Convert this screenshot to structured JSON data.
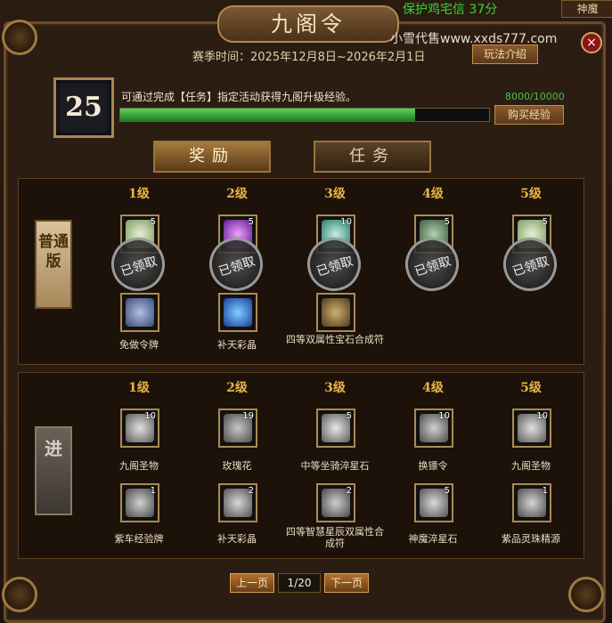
{
  "window": {
    "title": "九阁令",
    "top_tag": "保护鸡宅信 37分",
    "top_right_tag": "神魔",
    "watermark": "小雪代售www.xxds777.com",
    "close_icon": "×"
  },
  "header": {
    "season_label": "赛季时间：2025年12月8日~2026年2月1日",
    "rules_button": "玩法介绍",
    "level": "25",
    "description": "可通过完成【任务】指定活动获得九阁升级经验。",
    "exp_text": "8000/10000",
    "exp_progress": 0.8,
    "buy_exp_button": "购买经验"
  },
  "tabs": [
    {
      "label": "奖励",
      "active": true
    },
    {
      "label": "任务",
      "active": false
    }
  ],
  "tiers": {
    "normal": {
      "badge": "普通版",
      "levels": [
        "1级",
        "2级",
        "3级",
        "4级",
        "5级"
      ],
      "claimed_label": "已领取",
      "items_top": [
        {
          "count": "5",
          "color": "#c8d8b0"
        },
        {
          "count": "5",
          "color": "#9a5ad0"
        },
        {
          "count": "10",
          "color": "#6ab8a0"
        },
        {
          "count": "5",
          "color": "#7a9a7a"
        },
        {
          "count": "5",
          "color": "#c8d8b0"
        }
      ],
      "items_bottom": [
        {
          "name": "免做令牌",
          "color": "#6a7aa8"
        },
        {
          "name": "补天彩晶",
          "color": "#4a78c8"
        },
        {
          "name": "四等双属性宝石合成符",
          "color": "#7a6a40"
        },
        {
          "name": "",
          "color": ""
        },
        {
          "name": "",
          "color": ""
        }
      ]
    },
    "advanced": {
      "badge": "进",
      "levels": [
        "1级",
        "2级",
        "3级",
        "4级",
        "5级"
      ],
      "items_top": [
        {
          "name": "九阁圣物",
          "count": "10",
          "color": "#a8a8a8"
        },
        {
          "name": "玫瑰花",
          "count": "19",
          "color": "#8a8a8a"
        },
        {
          "name": "中等坐骑淬星石",
          "count": "5",
          "color": "#b0b0b0"
        },
        {
          "name": "换镖令",
          "count": "10",
          "color": "#9a9a9a"
        },
        {
          "name": "九阁圣物",
          "count": "10",
          "color": "#a8a8a8"
        }
      ],
      "items_bottom": [
        {
          "name": "紫车经验牌",
          "count": "1",
          "color": "#8a8a8a"
        },
        {
          "name": "补天彩晶",
          "count": "2",
          "color": "#9a9a9a"
        },
        {
          "name": "四等智慧星辰双属性合成符",
          "count": "2",
          "color": "#8a8a8a"
        },
        {
          "name": "神魔淬星石",
          "count": "5",
          "color": "#a0a0a0"
        },
        {
          "name": "紫品灵珠精源",
          "count": "1",
          "color": "#9a9a9a"
        }
      ]
    }
  },
  "pager": {
    "prev": "上一页",
    "page": "1/20",
    "next": "下一页"
  }
}
